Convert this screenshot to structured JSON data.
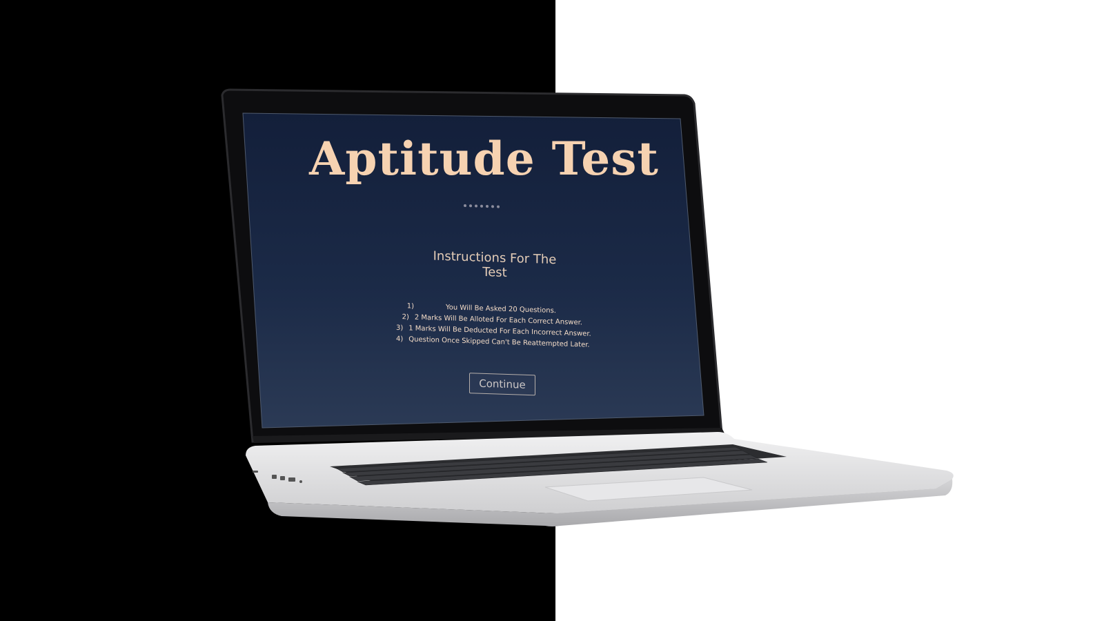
{
  "screen": {
    "title": "Aptitude Test",
    "subtitle": "Instructions For The Test",
    "instructions": [
      {
        "number": "1)",
        "text": "You Will Be Asked 20 Questions."
      },
      {
        "number": "2)",
        "text": "2 Marks Will Be Alloted For Each Correct Answer."
      },
      {
        "number": "3)",
        "text": "1 Marks Will Be Deducted For Each Incorrect Answer."
      },
      {
        "number": "4)",
        "text": "Question Once Skipped Can't Be Reattempted Later."
      }
    ],
    "continue_label": "Continue"
  },
  "colors": {
    "screen_background": "#1b2a47",
    "title_color": "#f6d2b1",
    "laptop_silver": "#d8d8da",
    "left_background": "#000000",
    "right_background": "#ffffff"
  }
}
